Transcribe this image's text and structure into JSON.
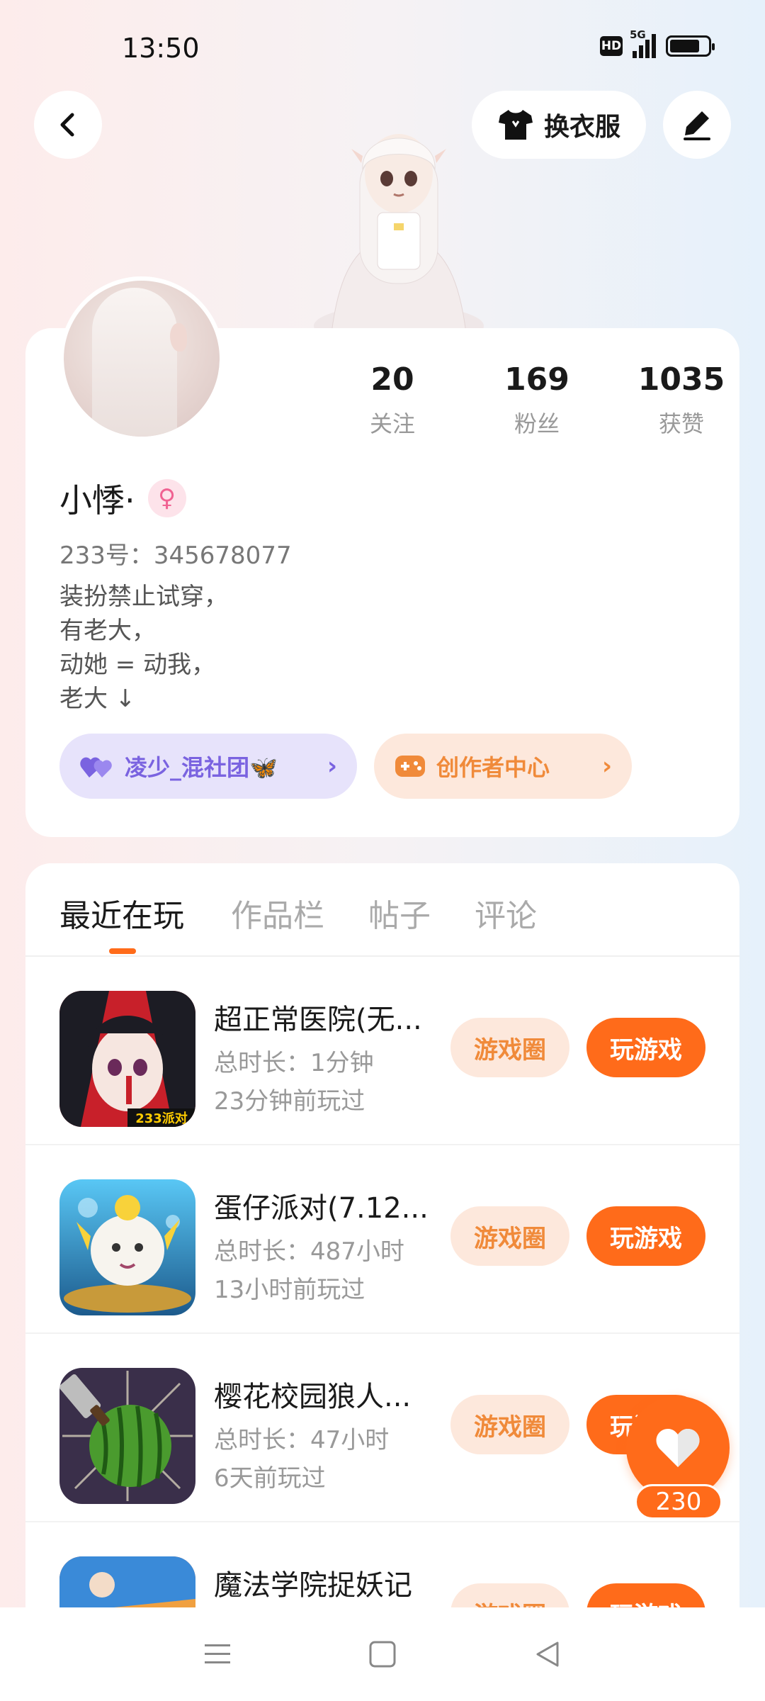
{
  "status_bar": {
    "time": "13:50",
    "hd": "HD",
    "network": "5G"
  },
  "header": {
    "outfit_label": "换衣服"
  },
  "profile": {
    "stats": [
      {
        "value": "20",
        "label": "关注"
      },
      {
        "value": "169",
        "label": "粉丝"
      },
      {
        "value": "1035",
        "label": "获赞"
      }
    ],
    "name": "小悸·",
    "gender_symbol": "♀",
    "id_text": "233号：345678077",
    "bio": [
      "装扮禁止试穿，",
      "有老大，",
      "动她 = 动我，",
      "老大 ↓"
    ],
    "club_chip": "凌少_混社团🦋",
    "creator_chip": "创作者中心"
  },
  "tabs": [
    "最近在玩",
    "作品栏",
    "帖子",
    "评论"
  ],
  "games": [
    {
      "title": "超正常医院(无...",
      "duration": "总时长：1分钟",
      "last_played": "23分钟前玩过",
      "icon_tag": "233派对"
    },
    {
      "title": "蛋仔派对(7.12...",
      "duration": "总时长：487小时",
      "last_played": "13小时前玩过"
    },
    {
      "title": "樱花校园狼人...",
      "duration": "总时长：47小时",
      "last_played": "6天前玩过"
    },
    {
      "title": "魔法学院捉妖记",
      "duration": "",
      "last_played": ""
    }
  ],
  "buttons": {
    "circle": "游戏圈",
    "play": "玩游戏"
  },
  "like": {
    "count": "230"
  },
  "colors": {
    "accent": "#ff6b1a",
    "accent_soft": "#fde8dc",
    "club": "#7a63e0"
  }
}
